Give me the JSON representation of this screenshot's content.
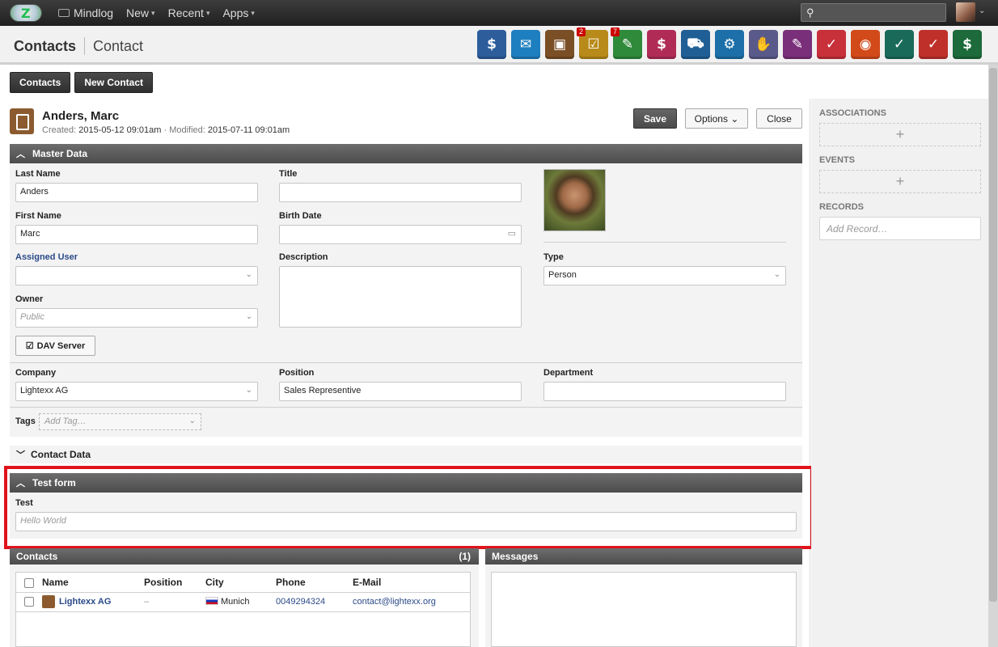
{
  "topbar": {
    "nav": [
      {
        "label": "Mindlog",
        "caret": false
      },
      {
        "label": "New",
        "caret": true
      },
      {
        "label": "Recent",
        "caret": true
      },
      {
        "label": "Apps",
        "caret": true
      }
    ],
    "search_value": ""
  },
  "header": {
    "crumb_primary": "Contacts",
    "crumb_secondary": "Contact",
    "app_icons": [
      {
        "name": "finance-app-icon",
        "color": "#2d5d9b",
        "glyph": "$"
      },
      {
        "name": "email-app-icon",
        "color": "#1d7fbf",
        "glyph": "✉"
      },
      {
        "name": "contacts-app-icon",
        "color": "#7a4f26",
        "glyph": "▣"
      },
      {
        "name": "tasks-app-icon",
        "color": "#b88a1a",
        "glyph": "☑",
        "badge": "2"
      },
      {
        "name": "notes-app-icon",
        "color": "#2f8a3a",
        "glyph": "✎",
        "badge": "7"
      },
      {
        "name": "sales-app-icon",
        "color": "#b02c56",
        "glyph": "$"
      },
      {
        "name": "delivery-app-icon",
        "color": "#1f5f96",
        "glyph": "⛟"
      },
      {
        "name": "support-app-icon",
        "color": "#1c6fa8",
        "glyph": "⚙"
      },
      {
        "name": "deals-app-icon",
        "color": "#5a5a8a",
        "glyph": "✋"
      },
      {
        "name": "documents-app-icon",
        "color": "#7a2f7a",
        "glyph": "✎"
      },
      {
        "name": "reports-app-icon",
        "color": "#c8303a",
        "glyph": "✓"
      },
      {
        "name": "broadcast-app-icon",
        "color": "#d24a1a",
        "glyph": "◉"
      },
      {
        "name": "shipping-app-icon",
        "color": "#1a6a5a",
        "glyph": "✓"
      },
      {
        "name": "projects-app-icon",
        "color": "#c0302a",
        "glyph": "✓"
      },
      {
        "name": "billing-app-icon",
        "color": "#1d6a3a",
        "glyph": "$"
      }
    ]
  },
  "toolbar": {
    "contacts_label": "Contacts",
    "new_contact_label": "New Contact"
  },
  "record": {
    "name": "Anders, Marc",
    "created_label": "Created:",
    "created": "2015-05-12 09:01am",
    "modified_label": "· Modified:",
    "modified": "2015-07-11 09:01am",
    "save_label": "Save",
    "options_label": "Options ⌄",
    "close_label": "Close"
  },
  "master": {
    "section_title": "Master Data",
    "last_name_label": "Last Name",
    "last_name": "Anders",
    "title_label": "Title",
    "title_value": "",
    "first_name_label": "First Name",
    "first_name": "Marc",
    "birth_date_label": "Birth Date",
    "birth_date": "",
    "assigned_user_label": "Assigned User",
    "assigned_user": "",
    "description_label": "Description",
    "type_label": "Type",
    "type_value": "Person",
    "owner_label": "Owner",
    "owner_placeholder": "Public",
    "dav_label": "DAV Server",
    "company_label": "Company",
    "company": "Lightexx AG",
    "position_label": "Position",
    "position": "Sales Representive",
    "department_label": "Department",
    "department": "",
    "tags_label": "Tags",
    "tags_placeholder": "Add Tag…"
  },
  "contact_data": {
    "section_title": "Contact Data"
  },
  "test_form": {
    "section_title": "Test form",
    "test_label": "Test",
    "test_placeholder": "Hello World"
  },
  "contacts_panel": {
    "title": "Contacts",
    "count": "(1)",
    "columns": [
      "Name",
      "Position",
      "City",
      "Phone",
      "E-Mail"
    ],
    "rows": [
      {
        "name": "Lightexx AG",
        "position": "–",
        "city": "Munich",
        "phone": "0049294324",
        "email": "contact@lightexx.org"
      }
    ]
  },
  "messages_panel": {
    "title": "Messages"
  },
  "sidebar": {
    "associations_label": "ASSOCIATIONS",
    "events_label": "EVENTS",
    "records_label": "RECORDS",
    "add_record_placeholder": "Add Record…",
    "add_glyph": "+"
  }
}
